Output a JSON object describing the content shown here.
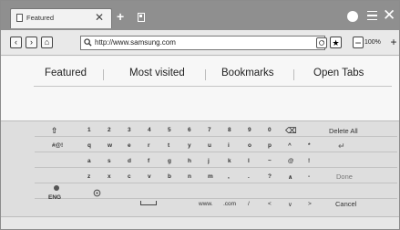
{
  "tab": {
    "title": "Featured",
    "close": "✕",
    "new": "+"
  },
  "window": {
    "close": "✕"
  },
  "toolbar": {
    "back": "‹",
    "forward": "›",
    "home": "⌂",
    "url": "http://www.samsung.com",
    "bookmark": "★",
    "zoom_out": "−",
    "zoom": "100%",
    "zoom_in": "+"
  },
  "content_tabs": [
    "Featured",
    "Most visited",
    "Bookmarks",
    "Open Tabs"
  ],
  "keyboard": {
    "row1": [
      "1",
      "2",
      "3",
      "4",
      "5",
      "6",
      "7",
      "8",
      "9",
      "0"
    ],
    "row2": [
      "q",
      "w",
      "e",
      "r",
      "t",
      "y",
      "u",
      "i",
      "o",
      "p",
      "^",
      "*"
    ],
    "row3": [
      "a",
      "s",
      "d",
      "f",
      "g",
      "h",
      "j",
      "k",
      "l",
      "~",
      "@",
      "!"
    ],
    "row4": [
      "z",
      "x",
      "c",
      "v",
      "b",
      "n",
      "m",
      ",",
      ".",
      "?",
      "∧",
      "-"
    ],
    "row5": [
      "www.",
      ".com",
      "/",
      "<",
      "∨",
      ">"
    ],
    "shift_label": "⇧",
    "mode_label": "#@!",
    "lang_label": "ENG",
    "delete_icon": "⌫",
    "delete_all": "Delete All",
    "enter": "↵",
    "done": "Done",
    "cancel": "Cancel"
  }
}
